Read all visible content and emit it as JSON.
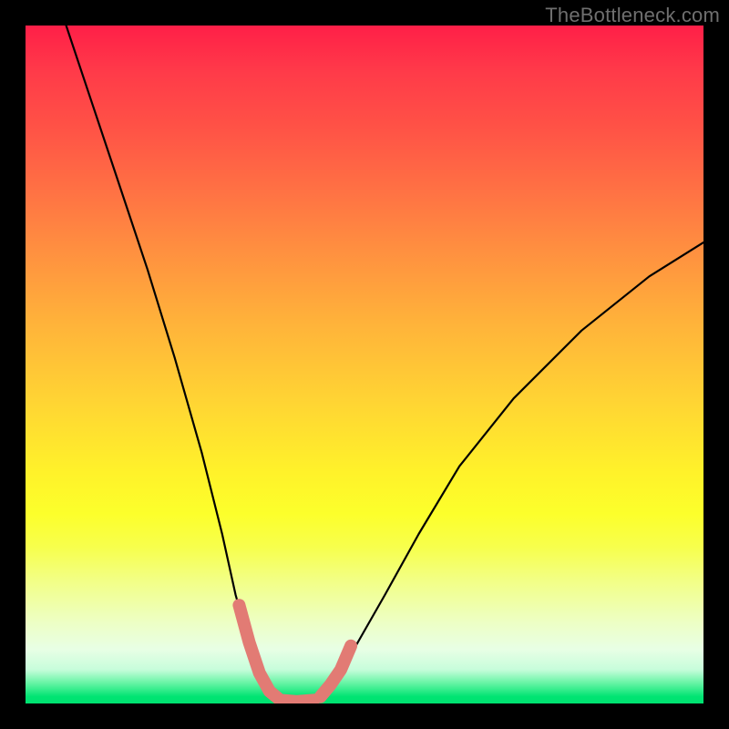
{
  "watermark": "TheBottleneck.com",
  "chart_data": {
    "type": "line",
    "title": "",
    "xlabel": "",
    "ylabel": "",
    "xlim": [
      0,
      100
    ],
    "ylim": [
      0,
      100
    ],
    "series": [
      {
        "name": "curve",
        "x": [
          6,
          10,
          14,
          18,
          22,
          26,
          29,
          31,
          33,
          35,
          36.5,
          38,
          40,
          42,
          44,
          46,
          49,
          53,
          58,
          64,
          72,
          82,
          92,
          100
        ],
        "y": [
          100,
          88,
          76,
          64,
          51,
          37,
          25,
          16,
          9,
          4,
          1.5,
          0.6,
          0.3,
          0.6,
          1.5,
          4,
          9,
          16,
          25,
          35,
          45,
          55,
          63,
          68
        ],
        "color": "#000000"
      }
    ],
    "highlight": {
      "note": "thick salmon segments along the curve near the valley",
      "color": "#e27b74",
      "segments": [
        {
          "x": [
            31.5,
            33.0,
            34.5,
            36.0,
            37.2
          ],
          "y": [
            14.5,
            9.0,
            4.5,
            1.8,
            0.8
          ]
        },
        {
          "x": [
            37.5,
            40.0,
            42.5
          ],
          "y": [
            0.5,
            0.3,
            0.5
          ]
        },
        {
          "x": [
            43.5,
            45.0,
            46.5,
            48.0
          ],
          "y": [
            1.0,
            2.8,
            5.0,
            8.5
          ]
        }
      ]
    },
    "background_gradient": {
      "direction": "vertical",
      "stops": [
        {
          "pos": 0,
          "color": "#ff1f48"
        },
        {
          "pos": 15,
          "color": "#ff5246"
        },
        {
          "pos": 33,
          "color": "#ff8f40"
        },
        {
          "pos": 56,
          "color": "#ffd633"
        },
        {
          "pos": 72,
          "color": "#fcff2b"
        },
        {
          "pos": 88,
          "color": "#edffc4"
        },
        {
          "pos": 97,
          "color": "#65f4a4"
        },
        {
          "pos": 100,
          "color": "#00e271"
        }
      ]
    }
  }
}
